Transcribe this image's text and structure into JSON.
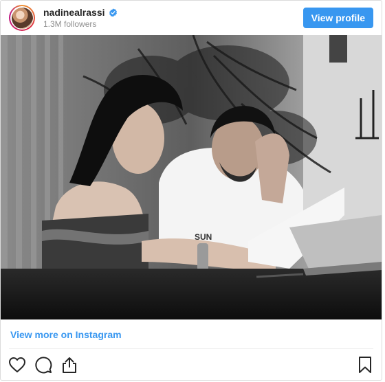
{
  "header": {
    "username": "nadinealrassi",
    "followers": "1.3M followers",
    "view_profile_label": "View profile",
    "avatar_icon": "profile-avatar",
    "verified_icon": "verified-badge-icon",
    "accent_color": "#3897f0"
  },
  "photo": {
    "style": "black-and-white photograph",
    "icon": "post-photo"
  },
  "footer": {
    "view_more_label": "View more on Instagram",
    "actions": [
      {
        "icon": "heart-icon"
      },
      {
        "icon": "comment-icon"
      },
      {
        "icon": "share-icon"
      },
      {
        "icon": "bookmark-icon"
      }
    ]
  }
}
